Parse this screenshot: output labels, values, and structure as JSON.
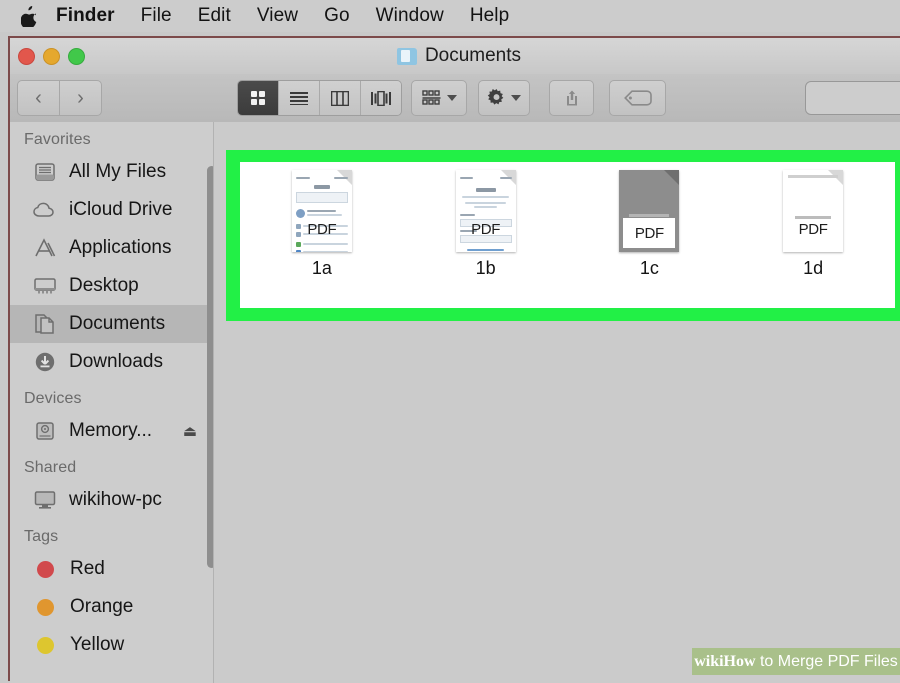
{
  "menubar": {
    "apple_icon": "apple-logo-icon",
    "items": [
      {
        "label": "Finder",
        "bold": true
      },
      {
        "label": "File",
        "bold": false
      },
      {
        "label": "Edit",
        "bold": false
      },
      {
        "label": "View",
        "bold": false
      },
      {
        "label": "Go",
        "bold": false
      },
      {
        "label": "Window",
        "bold": false
      },
      {
        "label": "Help",
        "bold": false
      }
    ]
  },
  "window": {
    "title": "Documents",
    "title_icon": "folder-icon",
    "traffic_lights": {
      "close_color": "#e2574c",
      "minimize_color": "#e5a82e",
      "zoom_color": "#41c84a"
    }
  },
  "toolbar": {
    "back_glyph": "‹",
    "forward_glyph": "›",
    "view_modes": [
      {
        "name": "icon-view",
        "selected": true
      },
      {
        "name": "list-view",
        "selected": false
      },
      {
        "name": "column-view",
        "selected": false
      },
      {
        "name": "coverflow-view",
        "selected": false
      }
    ],
    "arrange_icon": "arrange-grid-icon",
    "action_icon": "gear-icon",
    "share_icon": "share-icon",
    "tag_icon": "tag-icon",
    "search_placeholder": ""
  },
  "sidebar": {
    "sections": [
      {
        "header": "Favorites",
        "items": [
          {
            "label": "All My Files",
            "icon": "all-my-files-icon",
            "selected": false
          },
          {
            "label": "iCloud Drive",
            "icon": "cloud-icon",
            "selected": false
          },
          {
            "label": "Applications",
            "icon": "applications-icon",
            "selected": false
          },
          {
            "label": "Desktop",
            "icon": "desktop-icon",
            "selected": false
          },
          {
            "label": "Documents",
            "icon": "documents-icon",
            "selected": true
          },
          {
            "label": "Downloads",
            "icon": "downloads-icon",
            "selected": false
          }
        ]
      },
      {
        "header": "Devices",
        "items": [
          {
            "label": "Memory...",
            "icon": "hard-drive-icon",
            "selected": false,
            "eject": "⏏"
          }
        ]
      },
      {
        "header": "Shared",
        "items": [
          {
            "label": "wikihow-pc",
            "icon": "display-icon",
            "selected": false
          }
        ]
      },
      {
        "header": "Tags",
        "items": [
          {
            "label": "Red",
            "icon": "tag-dot-icon",
            "color": "#d1494c",
            "selected": false
          },
          {
            "label": "Orange",
            "icon": "tag-dot-icon",
            "color": "#e0962f",
            "selected": false
          },
          {
            "label": "Yellow",
            "icon": "tag-dot-icon",
            "color": "#ddc62f",
            "selected": false
          }
        ]
      }
    ]
  },
  "content": {
    "highlight_color": "#22f046",
    "files": [
      {
        "name": "1a",
        "kind": "pdf",
        "preview": "ios-settings-screenshot",
        "badge": "PDF"
      },
      {
        "name": "1b",
        "kind": "pdf",
        "preview": "apple-id-signin-screenshot",
        "badge": "PDF"
      },
      {
        "name": "1c",
        "kind": "pdf",
        "preview": "grey-document",
        "badge": "PDF"
      },
      {
        "name": "1d",
        "kind": "pdf",
        "preview": "white-document",
        "badge": "PDF"
      }
    ]
  },
  "watermark": {
    "brand_wiki": "wiki",
    "brand_how": "How",
    "tail": " to Merge PDF Files",
    "background": "#a9c08a"
  }
}
